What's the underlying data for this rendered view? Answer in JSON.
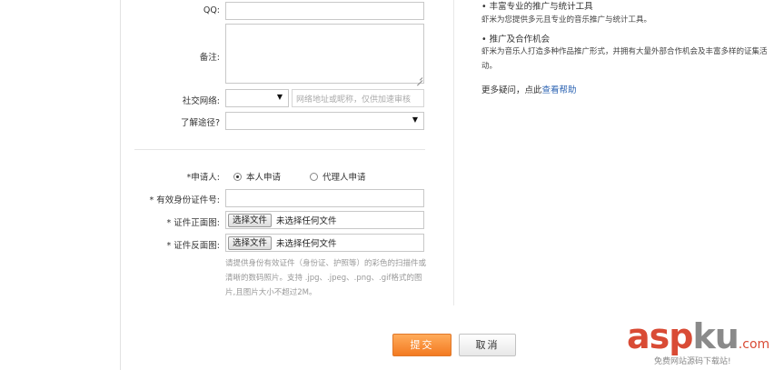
{
  "form": {
    "qq_label": "QQ:",
    "remark_label": "备注:",
    "social_label": "社交网络:",
    "social_select_arrow": "▼",
    "social_placeholder": "网络地址或昵称，仅供加速审核",
    "source_label": "了解途径?",
    "source_select_arrow": "▼",
    "applicant_label": "*申请人:",
    "applicant_options": [
      "本人申请",
      "代理人申请"
    ],
    "id_label": "* 有效身份证件号:",
    "front_label": "* 证件正面图:",
    "back_label": "* 证件反面图:",
    "file_button": "选择文件",
    "file_status": "未选择任何文件",
    "hint": "请提供身份有效证件（身份证、护照等）的彩色的扫描件或清晰的数码照片。支持 .jpg、.jpeg、.png、.gif格式的图片,且图片大小不超过2M。"
  },
  "sidebar": {
    "item1_title": "• 丰富专业的推广与统计工具",
    "item1_desc": "虾米为您提供多元且专业的音乐推广与统计工具。",
    "item2_title": "• 推广及合作机会",
    "item2_desc": "虾米为音乐人打造多种作品推广形式，并拥有大量外部合作机会及丰富多样的证集活动。",
    "more_prefix": "更多疑问，点此",
    "help_link": "查看帮助"
  },
  "actions": {
    "submit": "提交",
    "cancel": "取消"
  },
  "watermark": {
    "asp": "asp",
    "ku": "ku",
    "dot": ".com",
    "sub": "免费网站源码下载站!"
  },
  "colors": {
    "accent_orange": "#f37a21",
    "link_blue": "#2d64b3",
    "watermark_red": "#d94b35"
  }
}
